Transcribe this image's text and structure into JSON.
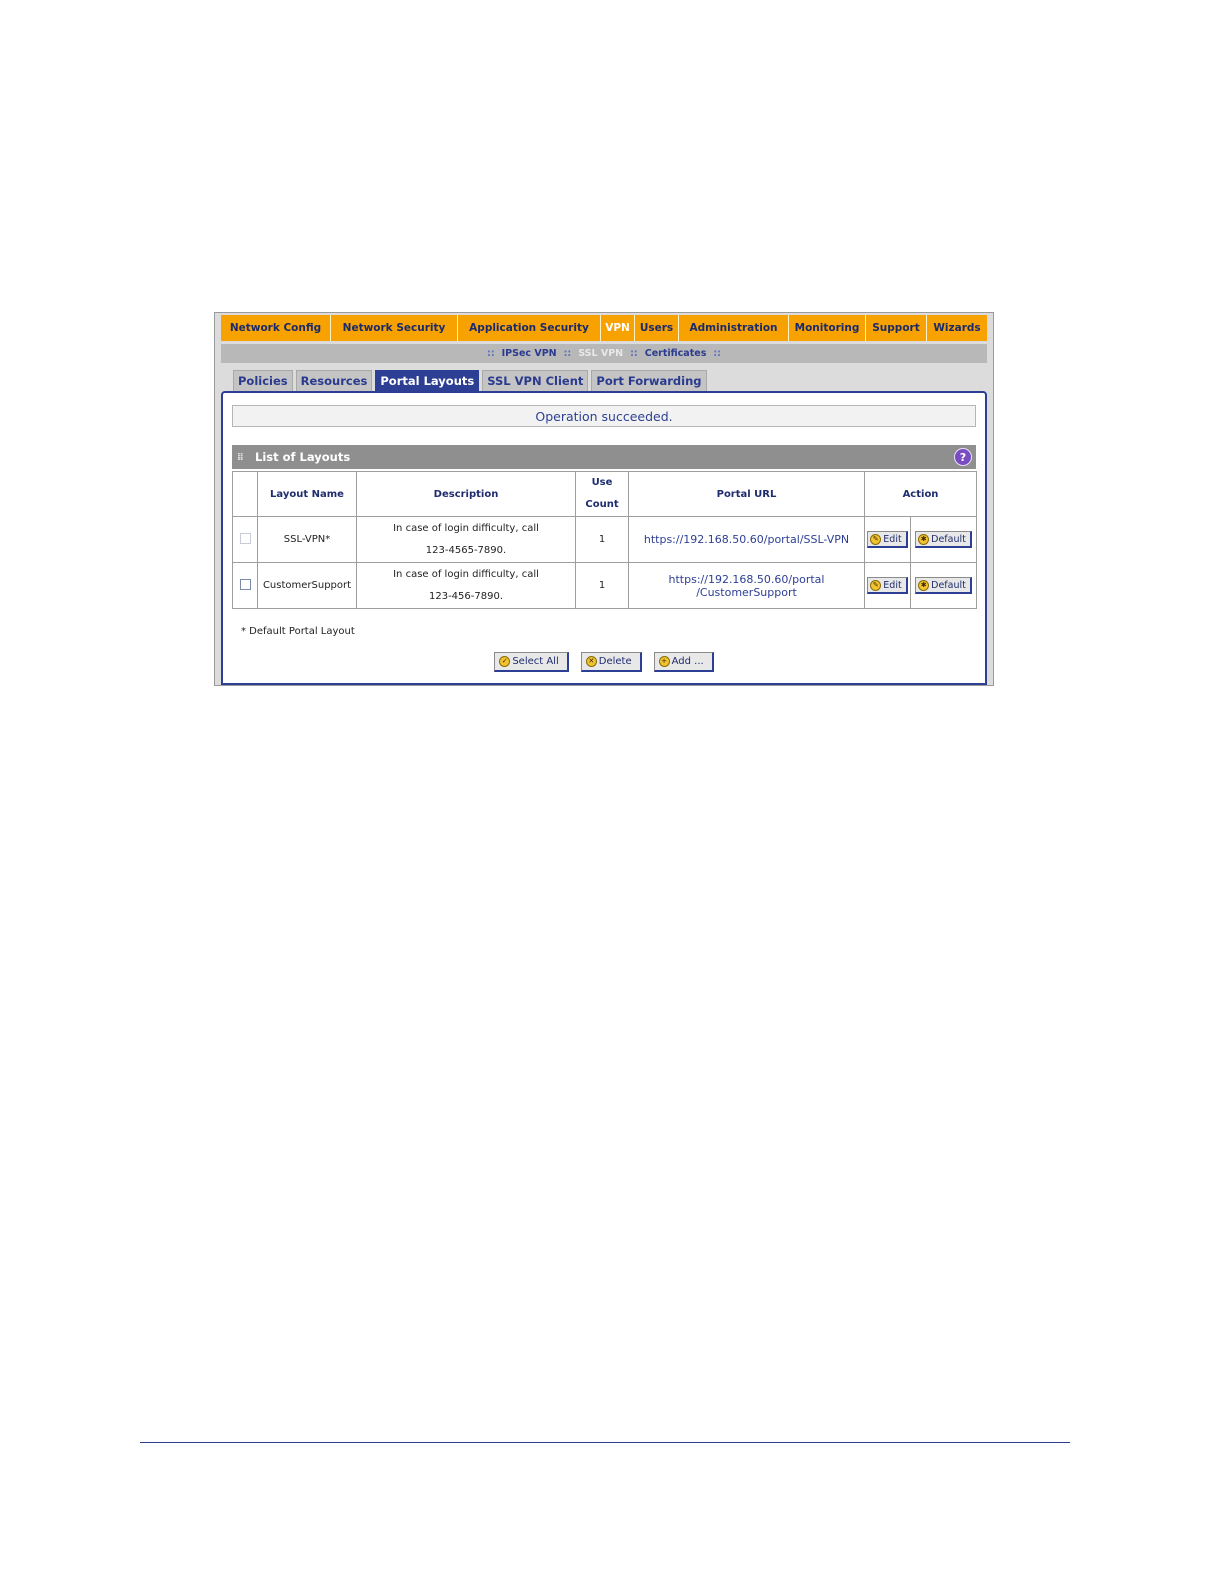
{
  "nav": {
    "items": [
      {
        "label": "Network Config",
        "active": false
      },
      {
        "label": "Network Security",
        "active": false
      },
      {
        "label": "Application Security",
        "active": false
      },
      {
        "label": "VPN",
        "active": true
      },
      {
        "label": "Users",
        "active": false
      },
      {
        "label": "Administration",
        "active": false
      },
      {
        "label": "Monitoring",
        "active": false
      },
      {
        "label": "Support",
        "active": false
      },
      {
        "label": "Wizards",
        "active": false
      }
    ],
    "sub": {
      "sep": "::",
      "items": [
        "IPSec VPN",
        "SSL VPN",
        "Certificates"
      ],
      "current": "SSL VPN"
    }
  },
  "tabs": [
    "Policies",
    "Resources",
    "Portal Layouts",
    "SSL VPN Client",
    "Port Forwarding"
  ],
  "active_tab": "Portal Layouts",
  "status_message": "Operation succeeded.",
  "list": {
    "title": "List of Layouts",
    "help_icon": "?",
    "columns": [
      "Layout Name",
      "Description",
      "Use",
      "Count",
      "Portal URL",
      "Action"
    ],
    "rows": [
      {
        "name": "SSL-VPN*",
        "desc_line1": "In case of login difficulty, call",
        "desc_line2": "123-4565-7890.",
        "use_count": "1",
        "url_line1": "https://192.168.50.60/portal/SSL-VPN",
        "url_line2": "",
        "checkbox_enabled": false
      },
      {
        "name": "CustomerSupport",
        "desc_line1": "In case of login difficulty, call",
        "desc_line2": "123-456-7890.",
        "use_count": "1",
        "url_line1": "https://192.168.50.60/portal",
        "url_line2": "/CustomerSupport",
        "checkbox_enabled": true
      }
    ],
    "edit_label": "Edit",
    "default_label": "Default"
  },
  "note": "* Default Portal Layout",
  "buttons": {
    "select_all": "Select All",
    "delete": "Delete",
    "add": "Add ..."
  },
  "colors": {
    "nav_bg": "#f7a200",
    "accent": "#2d3f94",
    "header_gray": "#8f8f8f"
  }
}
